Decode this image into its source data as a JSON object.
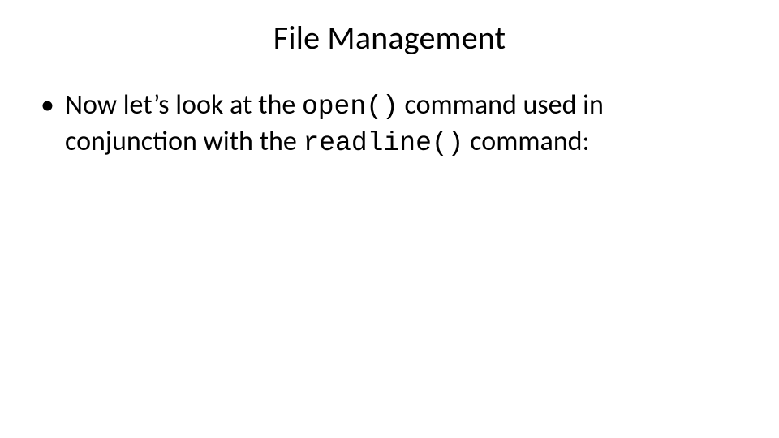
{
  "title": "File Management",
  "bullet": {
    "pre": "Now let’s look at the ",
    "code1": "open()",
    "mid": " command used in conjunction with the ",
    "code2": "readline()",
    "post": " command:"
  }
}
